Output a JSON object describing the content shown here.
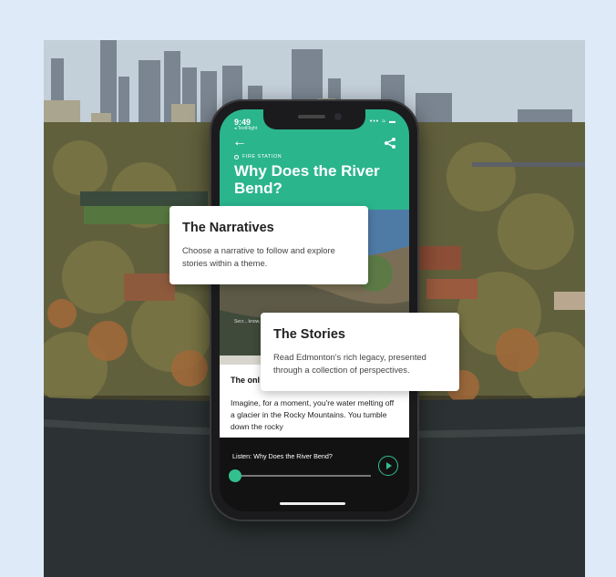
{
  "phone": {
    "status_time": "9:49",
    "status_back_app": "◂ TestFlight",
    "status_icons": "••• ≈ ▬",
    "section_label": "FIRE STATION",
    "title": "Why Does the River Bend?",
    "caption": "Secr... know...",
    "article_heading": "The onl",
    "article_text": "Imagine, for a moment, you're water melting off a glacier in the Rocky Mountains. You tumble down the rocky",
    "player_title": "Listen: Why Does the River Bend?",
    "player_progress_fraction": 0.03
  },
  "cards": {
    "narratives": {
      "title": "The Narratives",
      "description": "Choose a narrative to follow and explore stories within a theme."
    },
    "stories": {
      "title": "The Stories",
      "description": "Read Edmonton's rich legacy, presented through a collection of perspectives."
    }
  },
  "colors": {
    "accent": "#2bb58c",
    "page_background": "#dfeaf8",
    "player_background": "#121212"
  },
  "icons": [
    "back-arrow-icon",
    "share-icon",
    "play-icon"
  ]
}
